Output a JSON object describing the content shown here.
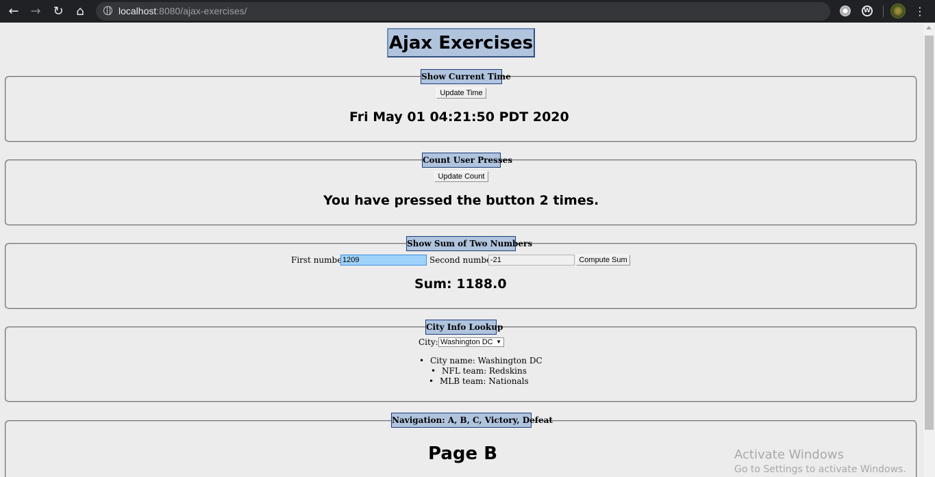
{
  "browser": {
    "url_host": "localhost",
    "url_path": ":8080/ajax-exercises/"
  },
  "page": {
    "title": "Ajax Exercises"
  },
  "time_section": {
    "legend": "Show Current Time",
    "button": "Update Time",
    "result": "Fri May 01 04:21:50 PDT 2020"
  },
  "count_section": {
    "legend": "Count User Presses",
    "button": "Update Count",
    "result": "You have pressed the button 2 times."
  },
  "sum_section": {
    "legend": "Show Sum of Two Numbers",
    "first_label": "First number:",
    "first_value": "1209",
    "second_label": "Second number:",
    "second_value": "-21",
    "button": "Compute Sum",
    "result": "Sum: 1188.0"
  },
  "city_section": {
    "legend": "City Info Lookup",
    "city_label": "City:",
    "selected_city": "Washington DC",
    "items": [
      "City name: Washington DC",
      "NFL team: Redskins",
      "MLB team: Nationals"
    ]
  },
  "nav_section": {
    "legend": "Navigation: A, B, C, Victory, Defeat",
    "result": "Page B"
  },
  "watermark": {
    "line1": "Activate Windows",
    "line2": "Go to Settings to activate Windows."
  },
  "icons": {
    "back": "back-arrow-icon",
    "forward": "forward-arrow-icon",
    "reload": "reload-icon",
    "home": "home-icon",
    "site_info": "globe-icon",
    "menu": "three-dots-icon"
  }
}
